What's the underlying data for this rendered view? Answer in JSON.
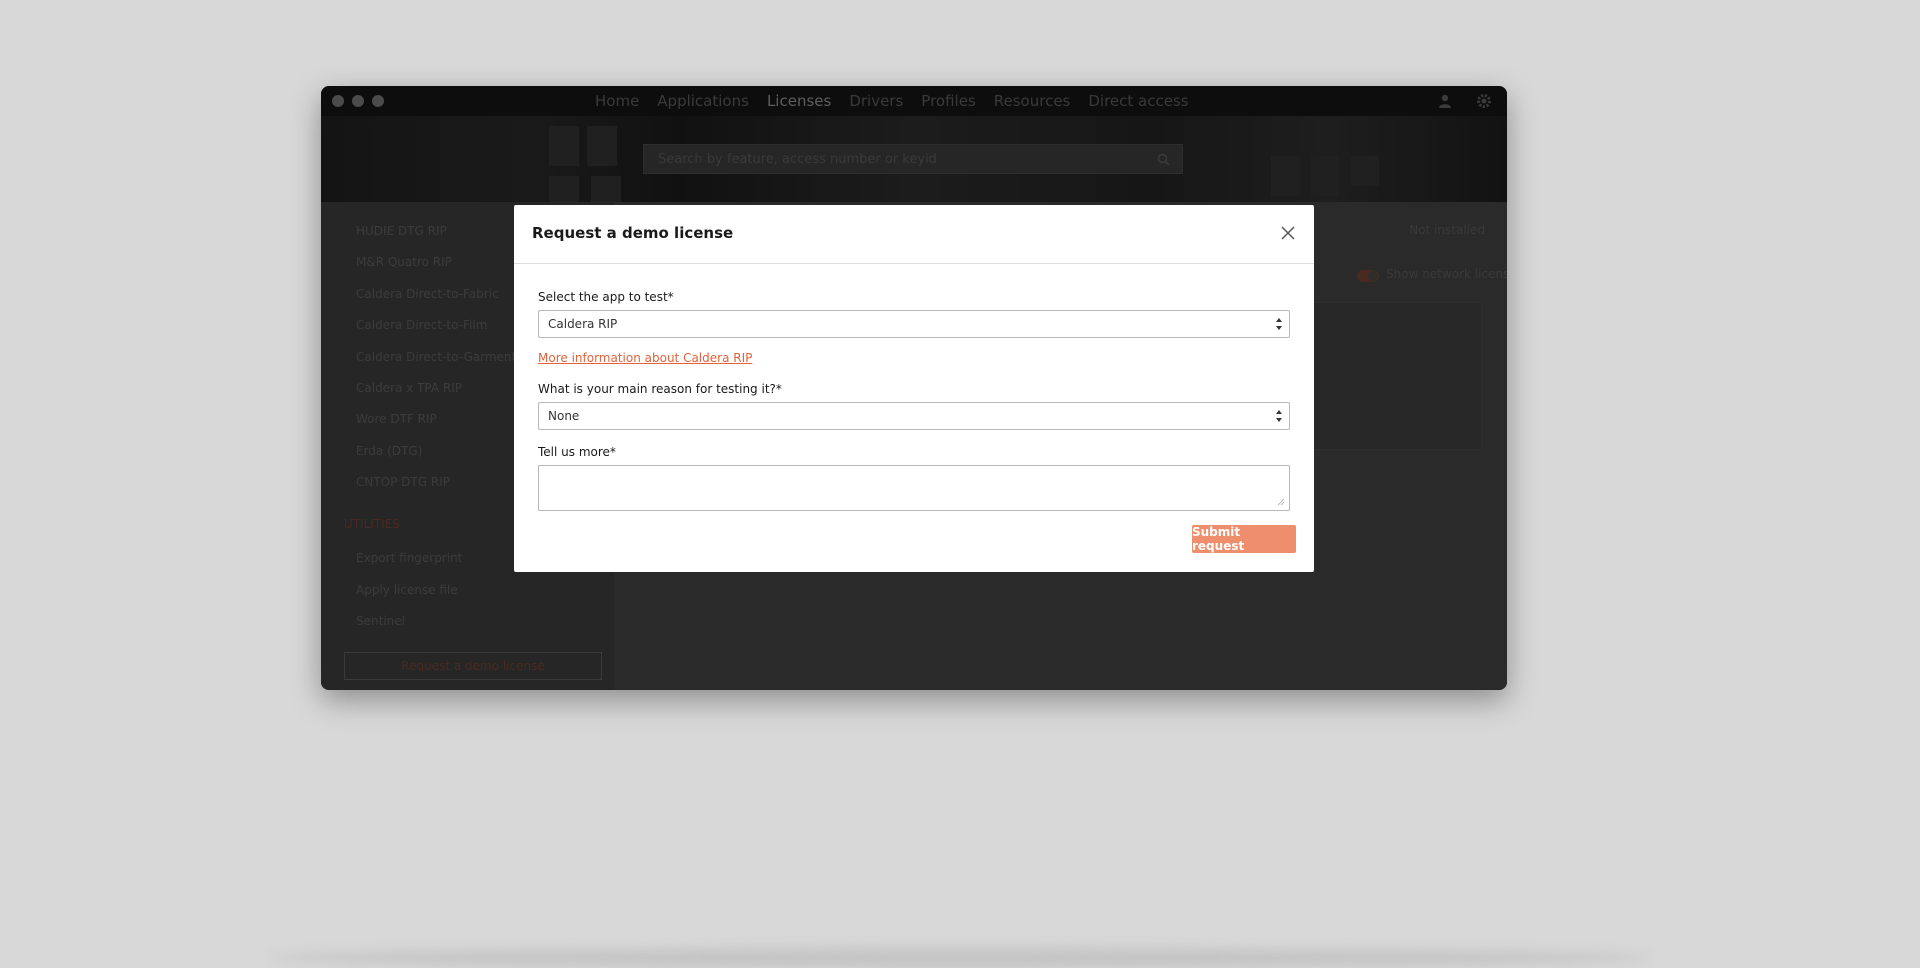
{
  "window": {
    "nav": {
      "items": [
        "Home",
        "Applications",
        "Licenses",
        "Drivers",
        "Profiles",
        "Resources",
        "Direct access"
      ],
      "active": "Licenses"
    },
    "search": {
      "placeholder": "Search by feature, access number or keyid"
    },
    "sidebar": {
      "apps": [
        "HUDIE DTG RIP",
        "M&R Quatro RIP",
        "Caldera Direct-to-Fabric",
        "Caldera Direct-to-Film",
        "Caldera Direct-to-Garment",
        "Caldera x TPA RIP",
        "Wore DTF RIP",
        "Erda (DTG)",
        "CNTOP DTG RIP"
      ],
      "utilities_heading": "UTILITIES",
      "utilities": [
        "Export fingerprint",
        "Apply license file",
        "Sentinel"
      ],
      "demo_button": "Request a demo license"
    },
    "main": {
      "status": "Not installed",
      "network_toggle_label": "Show network licenses"
    }
  },
  "modal": {
    "title": "Request a demo license",
    "app_label": "Select the app to test*",
    "app_value": "Caldera RIP",
    "info_link": "More information about Caldera RIP",
    "reason_label": "What is your main reason for testing it?*",
    "reason_value": "None",
    "more_label": "Tell us more*",
    "submit_label": "Submit request"
  },
  "colors": {
    "accent": "#e0633c",
    "submit_bg": "#ee8e6d",
    "backdrop": "#d8d8d8"
  }
}
